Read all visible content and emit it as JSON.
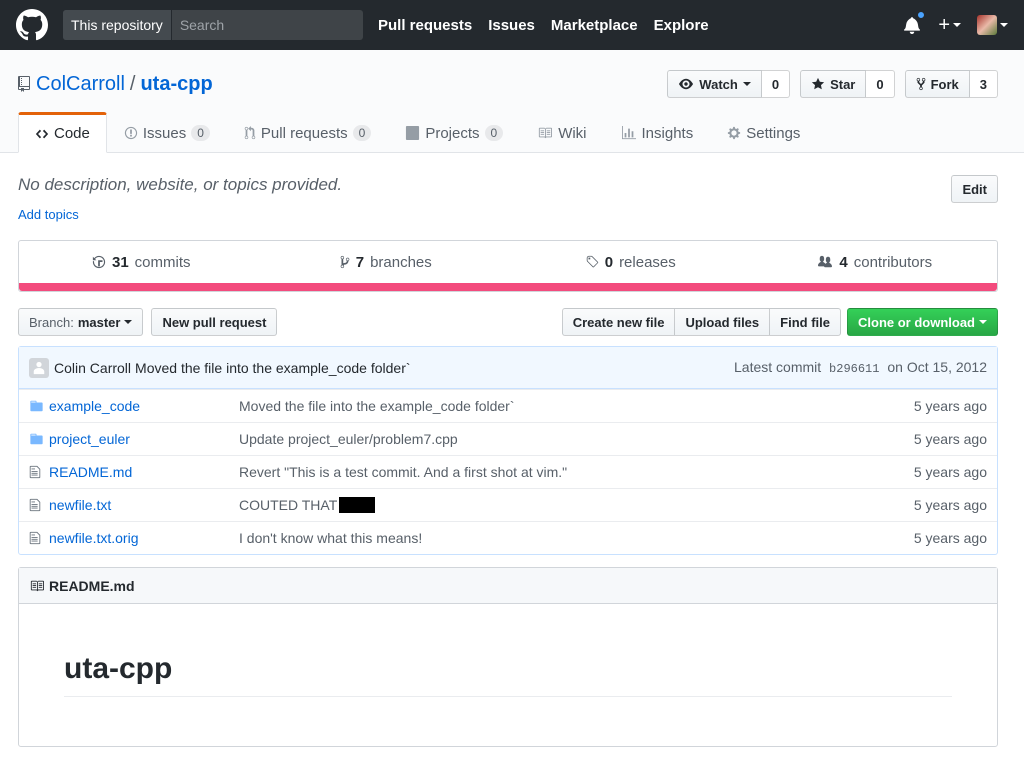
{
  "header": {
    "search_scope": "This repository",
    "search_placeholder": "Search",
    "nav": [
      "Pull requests",
      "Issues",
      "Marketplace",
      "Explore"
    ]
  },
  "repo": {
    "owner": "ColCarroll",
    "separator": "/",
    "name": "uta-cpp",
    "watch_label": "Watch",
    "watch_count": "0",
    "star_label": "Star",
    "star_count": "0",
    "fork_label": "Fork",
    "fork_count": "3"
  },
  "tabs": [
    {
      "label": "Code",
      "count": null,
      "icon": "code-icon",
      "active": true
    },
    {
      "label": "Issues",
      "count": "0",
      "icon": "issue-icon"
    },
    {
      "label": "Pull requests",
      "count": "0",
      "icon": "pull-request-icon"
    },
    {
      "label": "Projects",
      "count": "0",
      "icon": "project-icon"
    },
    {
      "label": "Wiki",
      "count": null,
      "icon": "book-icon"
    },
    {
      "label": "Insights",
      "count": null,
      "icon": "graph-icon"
    },
    {
      "label": "Settings",
      "count": null,
      "icon": "gear-icon"
    }
  ],
  "description": {
    "text": "No description, website, or topics provided.",
    "edit_label": "Edit",
    "add_topics": "Add topics"
  },
  "summary": {
    "commits_num": "31",
    "commits_label": "commits",
    "branches_num": "7",
    "branches_label": "branches",
    "releases_num": "0",
    "releases_label": "releases",
    "contributors_num": "4",
    "contributors_label": "contributors",
    "lang_color": "#f34b7d"
  },
  "filenav": {
    "branch_label": "Branch:",
    "branch_value": "master",
    "new_pr": "New pull request",
    "create_file": "Create new file",
    "upload_files": "Upload files",
    "find_file": "Find file",
    "clone": "Clone or download"
  },
  "commit": {
    "author": "Colin Carroll",
    "message": "Moved the file into the example_code folder`",
    "latest_label": "Latest commit",
    "sha": "b296611",
    "date": "on Oct 15, 2012"
  },
  "files": [
    {
      "type": "dir",
      "name": "example_code",
      "message": "Moved the file into the example_code folder`",
      "age": "5 years ago"
    },
    {
      "type": "dir",
      "name": "project_euler",
      "message": "Update project_euler/problem7.cpp",
      "age": "5 years ago"
    },
    {
      "type": "file",
      "name": "README.md",
      "message": "Revert \"This is a test commit. And a first shot at vim.\"",
      "age": "5 years ago"
    },
    {
      "type": "file",
      "name": "newfile.txt",
      "message": "COUTED THAT",
      "age": "5 years ago",
      "redacted": true
    },
    {
      "type": "file",
      "name": "newfile.txt.orig",
      "message": "I don't know what this means!",
      "age": "5 years ago"
    }
  ],
  "readme": {
    "filename": "README.md",
    "heading": "uta-cpp"
  },
  "colors": {
    "header_bg": "#24292e",
    "link": "#0366d6",
    "green": "#28a745",
    "tab_accent": "#e36209"
  }
}
